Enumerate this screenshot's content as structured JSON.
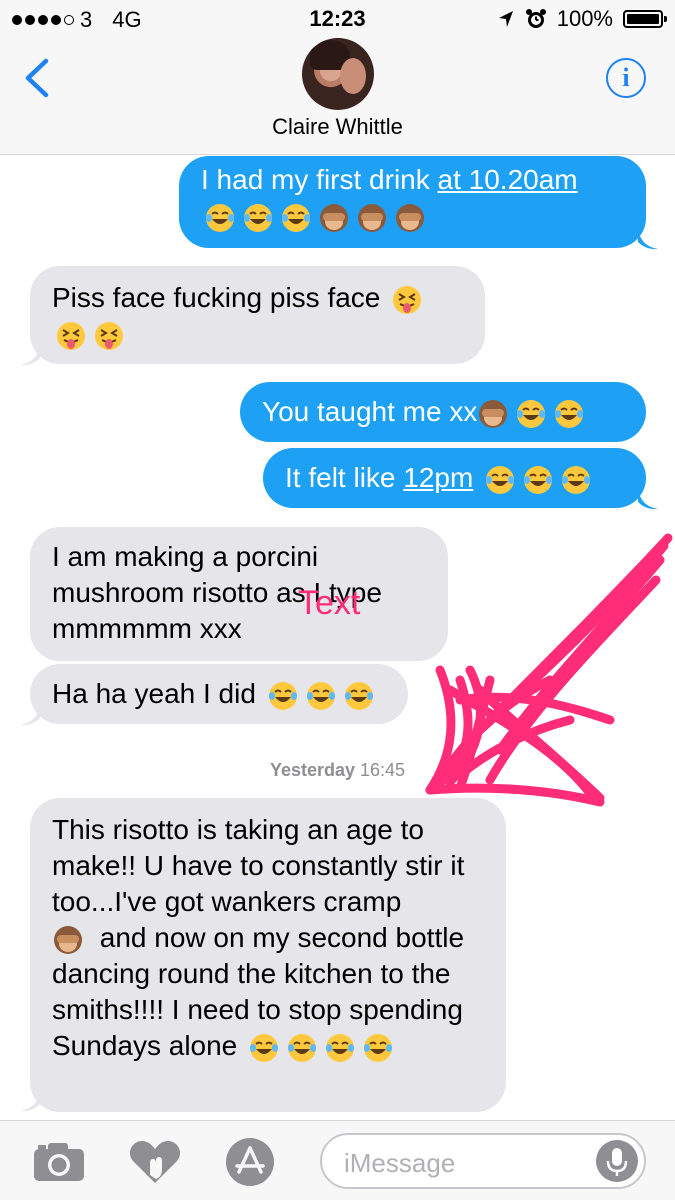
{
  "status_bar": {
    "carrier": "3",
    "network": "4G",
    "time": "12:23",
    "battery_percent": "100%",
    "battery_level": 1.0,
    "signal_bars_filled": 4,
    "signal_bars_total": 5
  },
  "header": {
    "contact_name": "Claire Whittle",
    "info_label": "i"
  },
  "messages": [
    {
      "sender": "me",
      "parts": [
        "I had my first drink ",
        "at 10.20am"
      ],
      "link_index": 1,
      "emojis": [
        "laughing-crying",
        "laughing-crying",
        "laughing-crying",
        "see-no-evil-monkey",
        "see-no-evil-monkey",
        "see-no-evil-monkey"
      ]
    },
    {
      "sender": "them",
      "text": "Piss face fucking piss face",
      "emojis": [
        "tongue-out",
        "tongue-out",
        "tongue-out"
      ]
    },
    {
      "sender": "me",
      "text": "You taught me xx",
      "emojis": [
        "see-no-evil-monkey",
        "laughing-crying",
        "laughing-crying"
      ]
    },
    {
      "sender": "me",
      "parts": [
        "It felt like ",
        "12pm"
      ],
      "link_index": 1,
      "emojis": [
        "laughing-crying",
        "laughing-crying",
        "laughing-crying"
      ]
    },
    {
      "sender": "them",
      "text": "I am making a porcini mushroom risotto as I type mmmmmm xxx"
    },
    {
      "sender": "them",
      "text": "Ha ha yeah I did",
      "emojis": [
        "laughing-crying",
        "laughing-crying",
        "laughing-crying"
      ]
    },
    {
      "sender": "them",
      "text_a": "This risotto is taking an age to make!! U have to constantly stir it too...I've got wankers cramp",
      "text_b": " and now on my second bottle dancing round the kitchen to the smiths!!!! I need to stop spending Sundays alone",
      "emojis": [
        "see-no-evil-monkey",
        "laughing-crying",
        "laughing-crying",
        "laughing-crying",
        "laughing-crying"
      ]
    }
  ],
  "timestamp": {
    "day": "Yesterday",
    "time": "16:45"
  },
  "annotation": {
    "text": "Text",
    "color": "#ff2d78"
  },
  "input": {
    "placeholder": "iMessage"
  },
  "colors": {
    "accent": "#1f82f2",
    "outgoing_bubble": "#1ea0f5",
    "incoming_bubble": "#e5e5ea"
  },
  "bottom_icons": [
    "camera-icon",
    "digital-touch-heart-icon",
    "app-store-icon",
    "microphone-icon"
  ]
}
